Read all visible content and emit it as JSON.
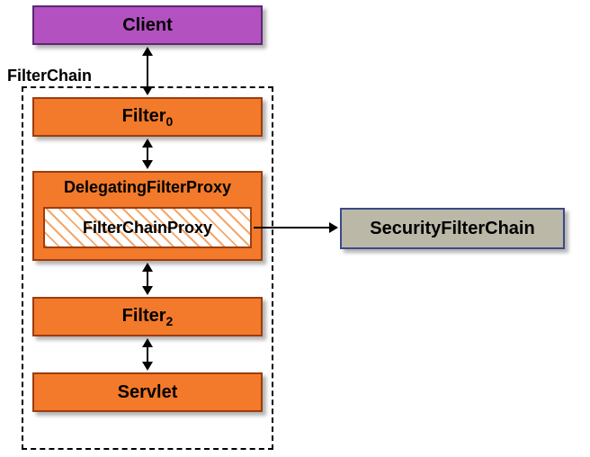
{
  "client": {
    "label": "Client"
  },
  "filterchain": {
    "label": "FilterChain"
  },
  "filter0": {
    "label": "Filter",
    "sub": "0"
  },
  "delegating": {
    "label": "DelegatingFilterProxy"
  },
  "proxy": {
    "label": "FilterChainProxy"
  },
  "filter2": {
    "label": "Filter",
    "sub": "2"
  },
  "servlet": {
    "label": "Servlet"
  },
  "security": {
    "label": "SecurityFilterChain"
  }
}
